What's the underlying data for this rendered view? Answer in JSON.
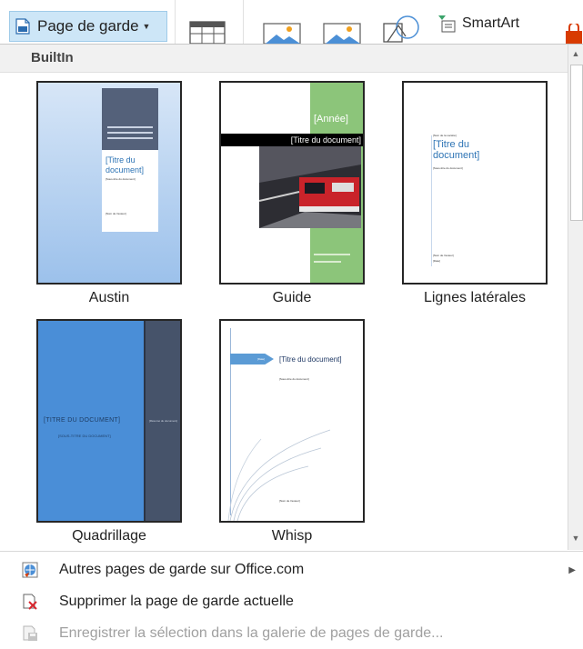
{
  "ribbon": {
    "cover_button_label": "Page de garde",
    "smartart_label": "SmartArt"
  },
  "gallery": {
    "section_header": "BuiltIn",
    "templates": [
      {
        "name": "Austin",
        "title": "[Titre du document]",
        "subtitle": "[Sous-titre du document]",
        "author": "[Nom de l'auteur]"
      },
      {
        "name": "Guide",
        "year": "[Année]",
        "title": "[Titre du document]"
      },
      {
        "name": "Lignes latérales",
        "company": "[Nom de la société]",
        "title": "[Titre du document]",
        "subtitle": "[Sous-titre du document]",
        "author": "[Nom de l'auteur]",
        "date": "[Date]"
      },
      {
        "name": "Quadrillage",
        "title": "[TITRE DU DOCUMENT]",
        "subtitle": "[SOUS-TITRE DU DOCUMENT]",
        "side": "[Résumé du document]"
      },
      {
        "name": "Whisp",
        "date": "[Date]",
        "title": "[Titre du document]",
        "subtitle": "[Sous-titre du document]",
        "author": "[Nom de l'auteur]"
      }
    ]
  },
  "menu": {
    "more_covers": "Autres pages de garde sur Office.com",
    "remove_cover": "Supprimer la page de garde actuelle",
    "save_selection": "Enregistrer la sélection dans la galerie de pages de garde..."
  }
}
